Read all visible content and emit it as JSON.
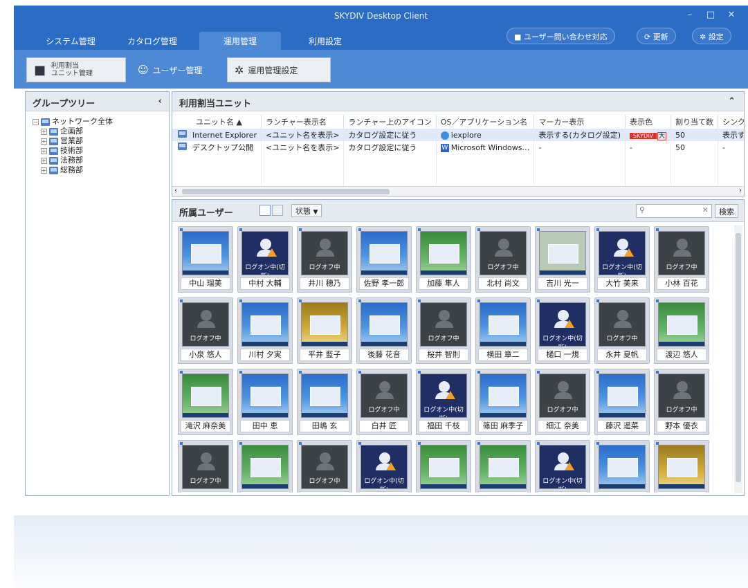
{
  "window": {
    "title": "SKYDIV Desktop Client"
  },
  "menu": {
    "tabs": [
      "システム管理",
      "カタログ管理",
      "運用管理",
      "利用設定"
    ],
    "active": 2
  },
  "header_buttons": {
    "inquiry": "ユーザー問い合わせ対応",
    "refresh": "更新",
    "settings": "設定"
  },
  "toolbar": {
    "unit_mgmt_line1": "利用割当",
    "unit_mgmt_line2": "ユニット管理",
    "user_mgmt": "ユーザー管理",
    "ops_settings": "運用管理設定"
  },
  "group_tree": {
    "title": "グループツリー",
    "root": "ネットワーク全体",
    "children": [
      "企画部",
      "営業部",
      "技術部",
      "法務部",
      "総務部"
    ]
  },
  "units": {
    "title": "利用割当ユニット",
    "columns": [
      "ユニット名 ▲",
      "ランチャー表示名",
      "ランチャー上のアイコン",
      "OS／アプリケーション名",
      "マーカー表示",
      "表示色",
      "割り当て数",
      "シンクライアン"
    ],
    "rows": [
      [
        "Internet Explorer",
        "<ユニット名を表示>",
        "カタログ設定に従う",
        "iexplore",
        "表示する(カタログ設定)",
        "SKYDIV",
        "50",
        "表示する"
      ],
      [
        "デスクトップ公開",
        "<ユニット名を表示>",
        "カタログ設定に従う",
        "Microsoft Windows…",
        "-",
        "-",
        "50",
        "-"
      ]
    ],
    "color_badge_suffix": "大"
  },
  "users": {
    "title": "所属ユーザー",
    "status_filter": "状態",
    "search_button": "検索",
    "search_placeholder": "",
    "status_labels": {
      "off": "ログオフ中",
      "locked": "ログオン中(切断)"
    },
    "cards": [
      {
        "name": "中山 瑠美",
        "screen": "win"
      },
      {
        "name": "中村 大輔",
        "screen": "lock",
        "status": "ログオン中(切断)"
      },
      {
        "name": "井川 穂乃",
        "screen": "off",
        "status": "ログオフ中"
      },
      {
        "name": "佐野 孝一郎",
        "screen": "win"
      },
      {
        "name": "加藤 隼人",
        "screen": "green"
      },
      {
        "name": "北村 尚文",
        "screen": "off",
        "status": "ログオフ中"
      },
      {
        "name": "吉川 光一",
        "screen": "map"
      },
      {
        "name": "大竹 美来",
        "screen": "lock",
        "status": "ログオン中(切断)"
      },
      {
        "name": "小林 百花",
        "screen": "off",
        "status": "ログオフ中"
      },
      {
        "name": "小泉 悠人",
        "screen": "off",
        "status": "ログオフ中"
      },
      {
        "name": "川村 夕実",
        "screen": "win"
      },
      {
        "name": "平井 藍子",
        "screen": "gold"
      },
      {
        "name": "後藤 花音",
        "screen": "win"
      },
      {
        "name": "桜井 智則",
        "screen": "off",
        "status": "ログオフ中"
      },
      {
        "name": "横田 章二",
        "screen": "win"
      },
      {
        "name": "樋口 一規",
        "screen": "lock",
        "status": "ログオン中(切断)"
      },
      {
        "name": "永井 夏帆",
        "screen": "off",
        "status": "ログオフ中"
      },
      {
        "name": "渡辺 悠人",
        "screen": "green"
      },
      {
        "name": "滝沢 麻奈美",
        "screen": "green"
      },
      {
        "name": "田中 恵",
        "screen": "win"
      },
      {
        "name": "田嶋 玄",
        "screen": "win"
      },
      {
        "name": "白井 匠",
        "screen": "off",
        "status": "ログオフ中"
      },
      {
        "name": "福田 千枝",
        "screen": "lock",
        "status": "ログオン中(切断)"
      },
      {
        "name": "篠田 麻季子",
        "screen": "win"
      },
      {
        "name": "細江 奈美",
        "screen": "off",
        "status": "ログオフ中"
      },
      {
        "name": "藤沢 遥菜",
        "screen": "win"
      },
      {
        "name": "野本 優衣",
        "screen": "off",
        "status": "ログオフ中"
      },
      {
        "name": "",
        "screen": "off",
        "status": "ログオフ中"
      },
      {
        "name": "",
        "screen": "green"
      },
      {
        "name": "",
        "screen": "off",
        "status": "ログオフ中"
      },
      {
        "name": "",
        "screen": "lock",
        "status": "ログオン中(切断)"
      },
      {
        "name": "",
        "screen": "green"
      },
      {
        "name": "",
        "screen": "green"
      },
      {
        "name": "",
        "screen": "lock",
        "status": "ログオン中(切断)"
      },
      {
        "name": "",
        "screen": "win"
      },
      {
        "name": "",
        "screen": "gold"
      }
    ]
  }
}
